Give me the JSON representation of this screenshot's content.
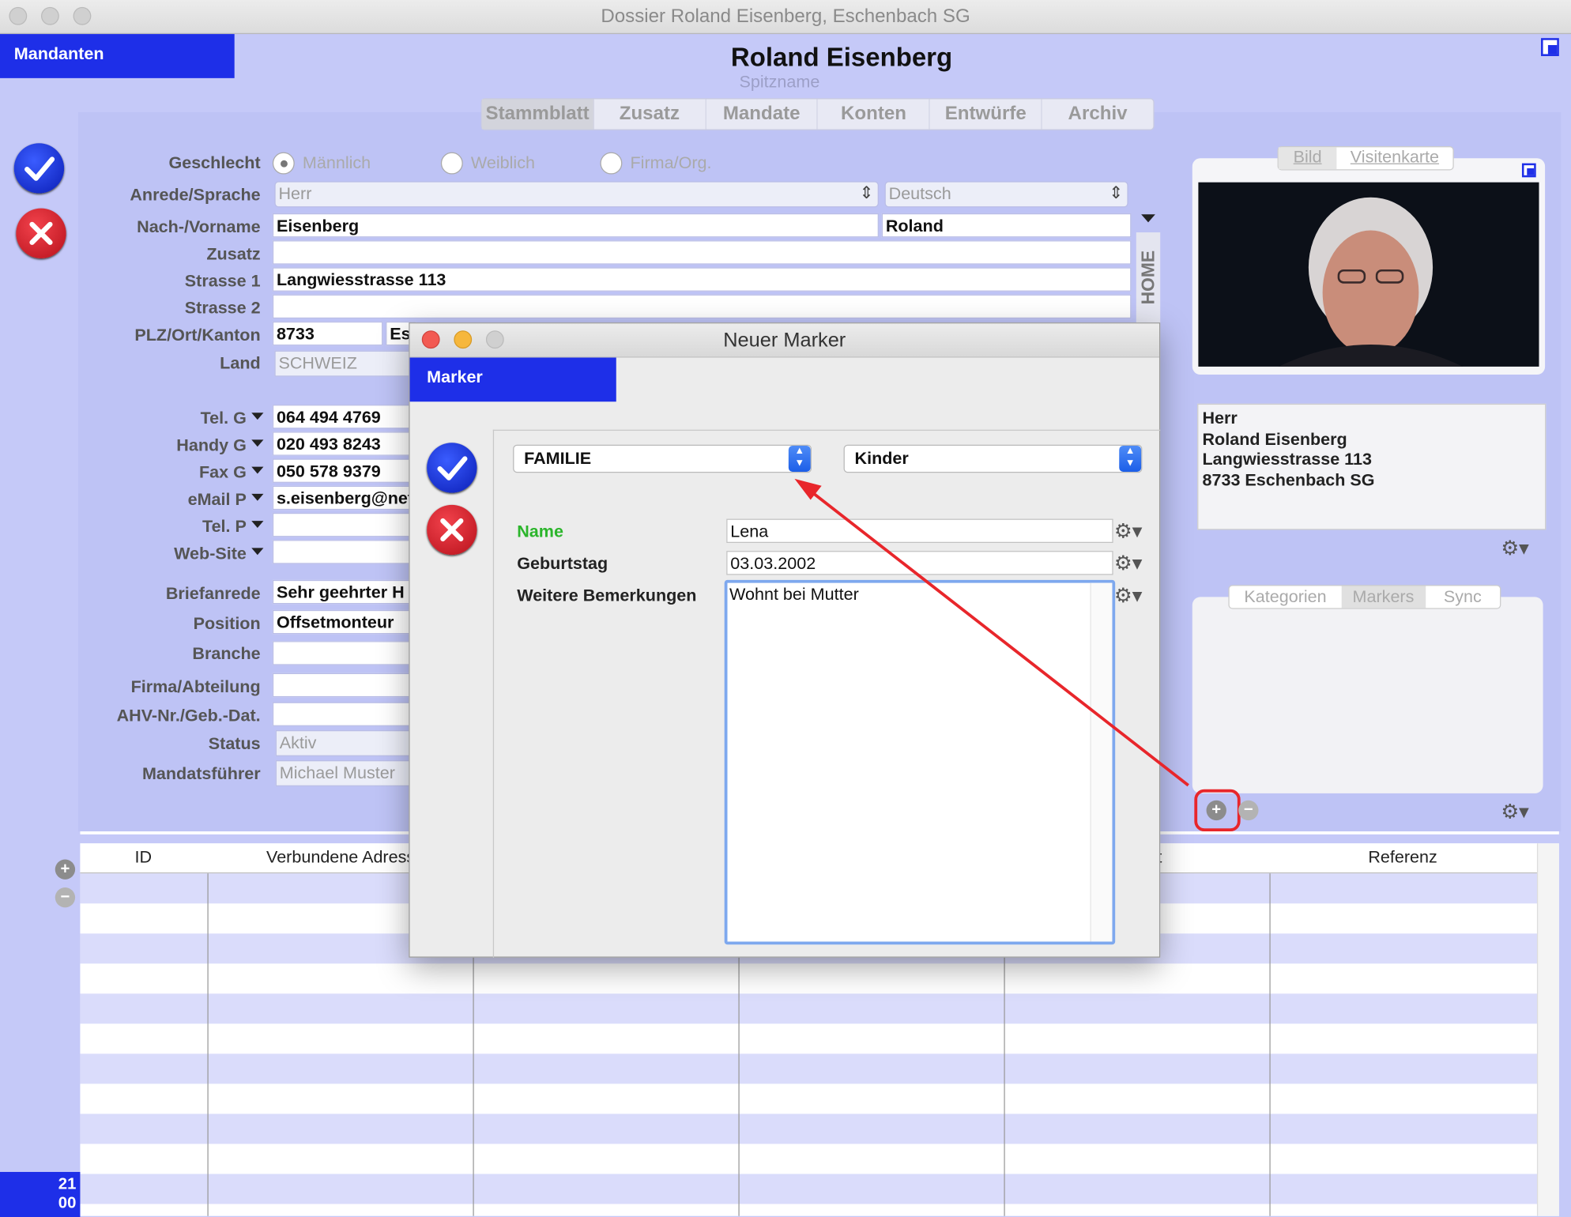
{
  "window": {
    "title": "Dossier Roland Eisenberg, Eschenbach SG"
  },
  "sidebar": {
    "mandanten_label": "Mandanten",
    "clock_hour": "21",
    "clock_min": "00"
  },
  "header": {
    "name": "Roland Eisenberg",
    "nickname_placeholder": "Spitzname"
  },
  "tabs": [
    "Stammblatt",
    "Zusatz",
    "Mandate",
    "Konten",
    "Entwürfe",
    "Archiv"
  ],
  "form": {
    "geschlecht_label": "Geschlecht",
    "gender_options": [
      "Männlich",
      "Weiblich",
      "Firma/Org."
    ],
    "anrede_label": "Anrede/Sprache",
    "anrede_value": "Herr",
    "sprache_value": "Deutsch",
    "name_label": "Nach-/Vorname",
    "nachname": "Eisenberg",
    "vorname": "Roland",
    "zusatz_label": "Zusatz",
    "strasse1_label": "Strasse 1",
    "strasse1": "Langwiesstrasse 113",
    "strasse2_label": "Strasse 2",
    "plz_label": "PLZ/Ort/Kanton",
    "plz": "8733",
    "ort_partial": "Es",
    "land_label": "Land",
    "land": "SCHWEIZ",
    "home_vertical": "HOME",
    "tel_g_label": "Tel. G",
    "tel_g": "064 494 4769",
    "handy_g_label": "Handy G",
    "handy_g": "020 493 8243",
    "fax_g_label": "Fax G",
    "fax_g": "050 578 9379",
    "email_p_label": "eMail P",
    "email_p": "s.eisenberg@net",
    "tel_p_label": "Tel. P",
    "website_label": "Web-Site",
    "briefanrede_label": "Briefanrede",
    "briefanrede": "Sehr geehrter H",
    "position_label": "Position",
    "position": "Offsetmonteur",
    "branche_label": "Branche",
    "firma_label": "Firma/Abteilung",
    "ahv_label": "AHV-Nr./Geb.-Dat.",
    "status_label": "Status",
    "status": "Aktiv",
    "mandatsfuehrer_label": "Mandatsführer",
    "mandatsfuehrer": "Michael Muster"
  },
  "right_panel": {
    "bild_tab": "Bild",
    "visitenkarte_tab": "Visitenkarte",
    "address_lines": [
      "Herr",
      "Roland Eisenberg",
      "Langwiesstrasse 113",
      "8733 Eschenbach SG"
    ],
    "tabs2": [
      "Kategorien",
      "Markers",
      "Sync"
    ]
  },
  "table": {
    "columns": [
      "ID",
      "Verbundene Adress",
      "t",
      "Referenz"
    ]
  },
  "dialog": {
    "title": "Neuer Marker",
    "header": "Marker",
    "category": "FAMILIE",
    "subcategory": "Kinder",
    "name_label": "Name",
    "name_value": "Lena",
    "birthday_label": "Geburtstag",
    "birthday_value": "03.03.2002",
    "remarks_label": "Weitere Bemerkungen",
    "remarks_value": "Wohnt bei Mutter"
  },
  "colors": {
    "accent_blue": "#1e2fe8",
    "background": "#c5c9f8",
    "annotation_red": "#e8262b",
    "name_green": "#2bb52b"
  }
}
